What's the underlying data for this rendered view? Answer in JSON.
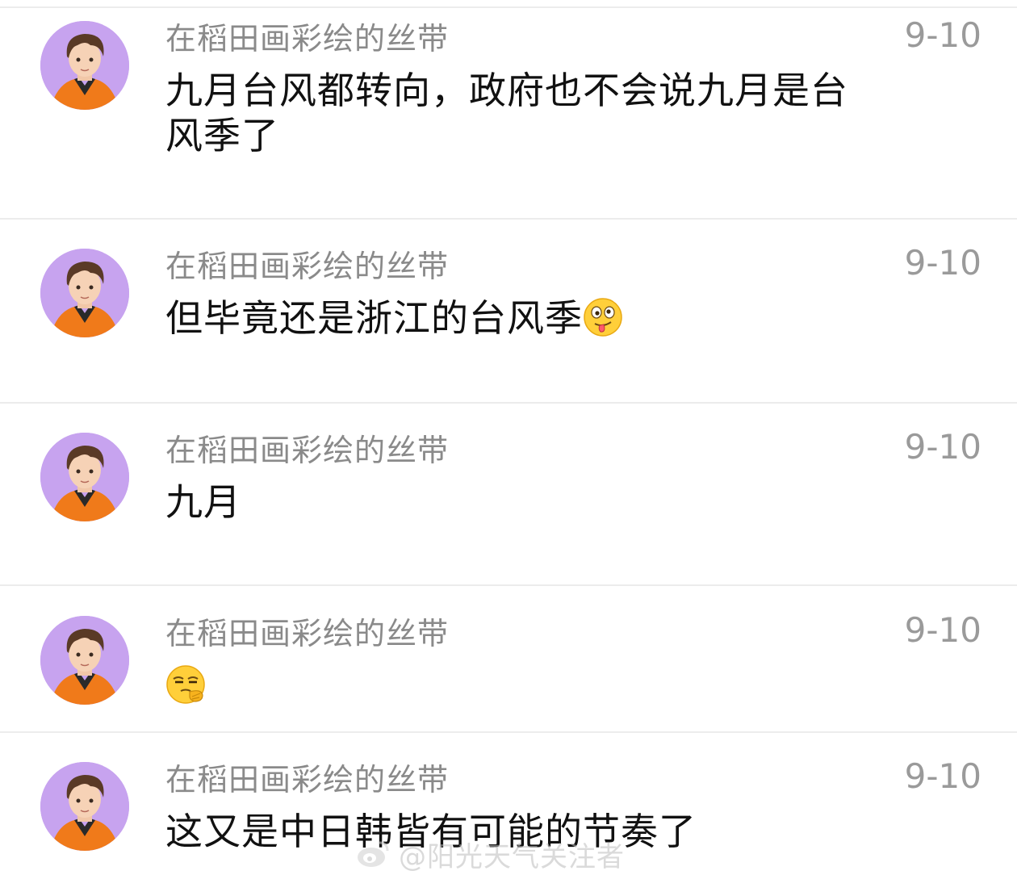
{
  "comments": [
    {
      "username": "在稻田画彩绘的丝带",
      "date": "9-10",
      "text": "九月台风都转向，政府也不会说九月是台风季了",
      "emoji": null
    },
    {
      "username": "在稻田画彩绘的丝带",
      "date": "9-10",
      "text": "但毕竟还是浙江的台风季",
      "emoji": "tongue-out-face-emoji"
    },
    {
      "username": "在稻田画彩绘的丝带",
      "date": "9-10",
      "text": "九月",
      "emoji": null
    },
    {
      "username": "在稻田画彩绘的丝带",
      "date": "9-10",
      "text": "",
      "emoji": "thinking-face-emoji"
    },
    {
      "username": "在稻田画彩绘的丝带",
      "date": "9-10",
      "text": "这又是中日韩皆有可能的节奏了",
      "emoji": null
    }
  ],
  "watermark": {
    "icon": "weibo-logo-icon",
    "text": "@阳光天气关注者"
  },
  "colors": {
    "avatar_background": "#c7a3ef",
    "username": "#8a8a8a",
    "date": "#9a9a9a",
    "message": "#111111",
    "divider": "#ececec"
  }
}
